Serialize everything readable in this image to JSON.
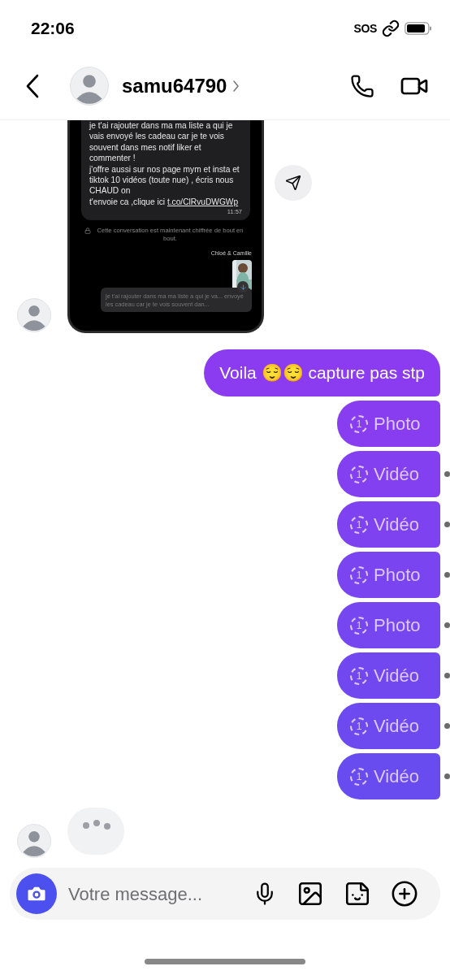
{
  "status_bar": {
    "time": "22:06",
    "sos": "SOS"
  },
  "header": {
    "username": "samu64790"
  },
  "shared_screenshot": {
    "message": "je t'ai rajouter dans ma ma liste a qui je vais envoyé les cadeau car je te vois souvent dans mes notif liker et commenter !\nj'offre aussi sur nos page mym et insta et tiktok 10 vidéos (toute nue) , écris nous CHAUD on\nt'envoie ca ,clique ici ",
    "link": "t.co/ClRvuDWGWp",
    "time": "11:57",
    "notice": "Cette conversation est maintenant chiffrée de bout en bout.",
    "sender_label": "Chloé & Camille",
    "reply_preview": "je t'ai rajouter dans ma ma liste a qui je va... envoyé les cadeau car je te vois souvent dan..."
  },
  "messages": [
    {
      "kind": "text",
      "text": "Voila 😌😌 capture pas stp"
    },
    {
      "kind": "media",
      "badge": "1",
      "label": "Photo",
      "dot": false
    },
    {
      "kind": "media",
      "badge": "1",
      "label": "Vidéo",
      "dot": true
    },
    {
      "kind": "media",
      "badge": "1",
      "label": "Vidéo",
      "dot": true
    },
    {
      "kind": "media",
      "badge": "1",
      "label": "Photo",
      "dot": true
    },
    {
      "kind": "media",
      "badge": "1",
      "label": "Photo",
      "dot": true
    },
    {
      "kind": "media",
      "badge": "1",
      "label": "Vidéo",
      "dot": true
    },
    {
      "kind": "media",
      "badge": "1",
      "label": "Vidéo",
      "dot": true
    },
    {
      "kind": "media",
      "badge": "1",
      "label": "Vidéo",
      "dot": true
    }
  ],
  "typing": true,
  "composer": {
    "placeholder": "Votre message..."
  }
}
